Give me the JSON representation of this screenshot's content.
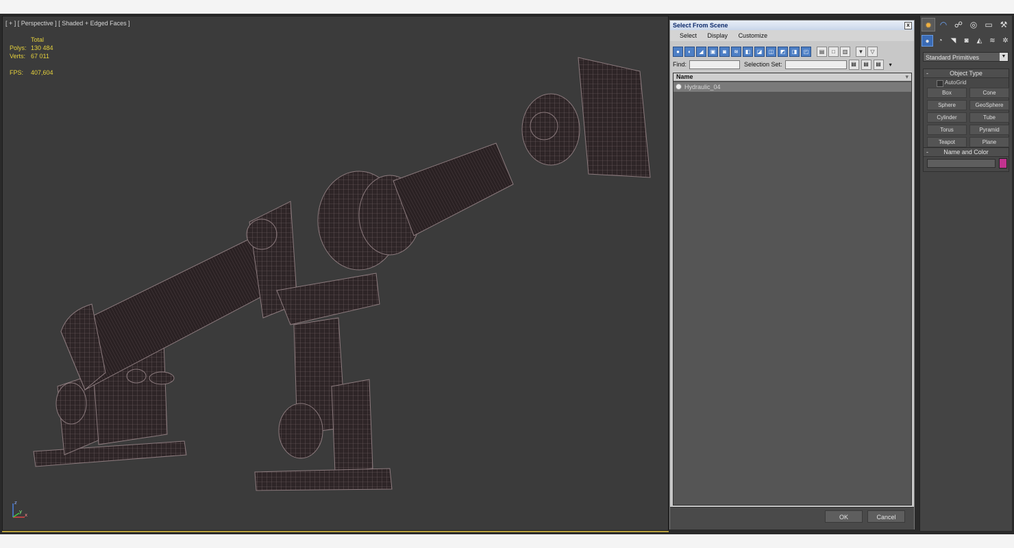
{
  "viewport": {
    "label": "[ + ] [ Perspective ] [ Shaded + Edged Faces ]",
    "stats": {
      "header": "Total",
      "polys_label": "Polys:",
      "polys_value": "130 484",
      "verts_label": "Verts:",
      "verts_value": "67 011",
      "fps_label": "FPS:",
      "fps_value": "407,604"
    },
    "gizmo": {
      "z": "z",
      "y": "y",
      "x": "x"
    }
  },
  "dialog": {
    "title": "Select From Scene",
    "close_glyph": "x",
    "menu": [
      "Select",
      "Display",
      "Customize"
    ],
    "find_label": "Find:",
    "find_value": "",
    "selection_set_label": "Selection Set:",
    "selection_set_value": "",
    "column_name": "Name",
    "items": [
      "Hydraulic_04"
    ],
    "ok_label": "OK",
    "cancel_label": "Cancel"
  },
  "command_panel": {
    "tabs": [
      "create-icon",
      "modify-icon",
      "hierarchy-icon",
      "motion-icon",
      "display-icon",
      "utilities-icon"
    ],
    "subtabs": [
      "geometry-icon",
      "shapes-icon",
      "lights-icon",
      "cameras-icon",
      "helpers-icon",
      "spacewarps-icon",
      "systems-icon"
    ],
    "category": "Standard Primitives",
    "object_type_title": "Object Type",
    "autogrid_label": "AutoGrid",
    "primitives": [
      "Box",
      "Cone",
      "Sphere",
      "GeoSphere",
      "Cylinder",
      "Tube",
      "Torus",
      "Pyramid",
      "Teapot",
      "Plane"
    ],
    "name_color_title": "Name and Color",
    "name_value": "",
    "swatch_color": "#c1338f"
  },
  "colors": {
    "viewport_bg": "#3b3b3b",
    "stats_text": "#e6d23c",
    "wire": "#7a6a6d",
    "mesh_fill": "#2e2527",
    "selection_highlight": "#4d7fc5"
  }
}
